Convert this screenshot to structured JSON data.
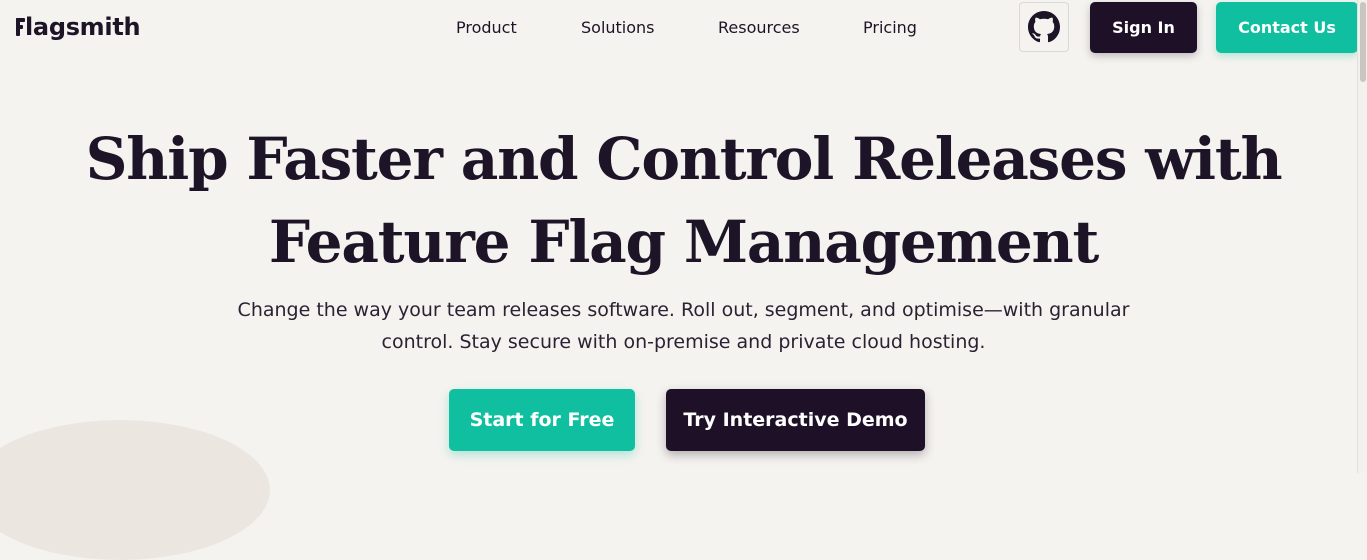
{
  "brand": {
    "name": "lagsmith",
    "logo_icon": "flagsmith-f-icon",
    "text_color": "#1d1427"
  },
  "nav": {
    "items": [
      {
        "label": "Product"
      },
      {
        "label": "Solutions"
      },
      {
        "label": "Resources"
      },
      {
        "label": "Pricing"
      }
    ]
  },
  "header_actions": {
    "github_icon": "github-icon",
    "sign_in_label": "Sign In",
    "contact_label": "Contact Us"
  },
  "hero": {
    "title_line_1": "Ship Faster and Control Releases with",
    "title_line_2": "Feature Flag Management",
    "subtitle_line_1": "Change the way your team releases software. Roll out, segment, and optimise—with granular",
    "subtitle_line_2": "control. Stay secure with on-premise and private cloud hosting.",
    "primary_cta": "Start for Free",
    "secondary_cta": "Try Interactive Demo"
  },
  "colors": {
    "background": "#f5f3ef",
    "dark": "#1d1027",
    "accent": "#10bfa0"
  }
}
